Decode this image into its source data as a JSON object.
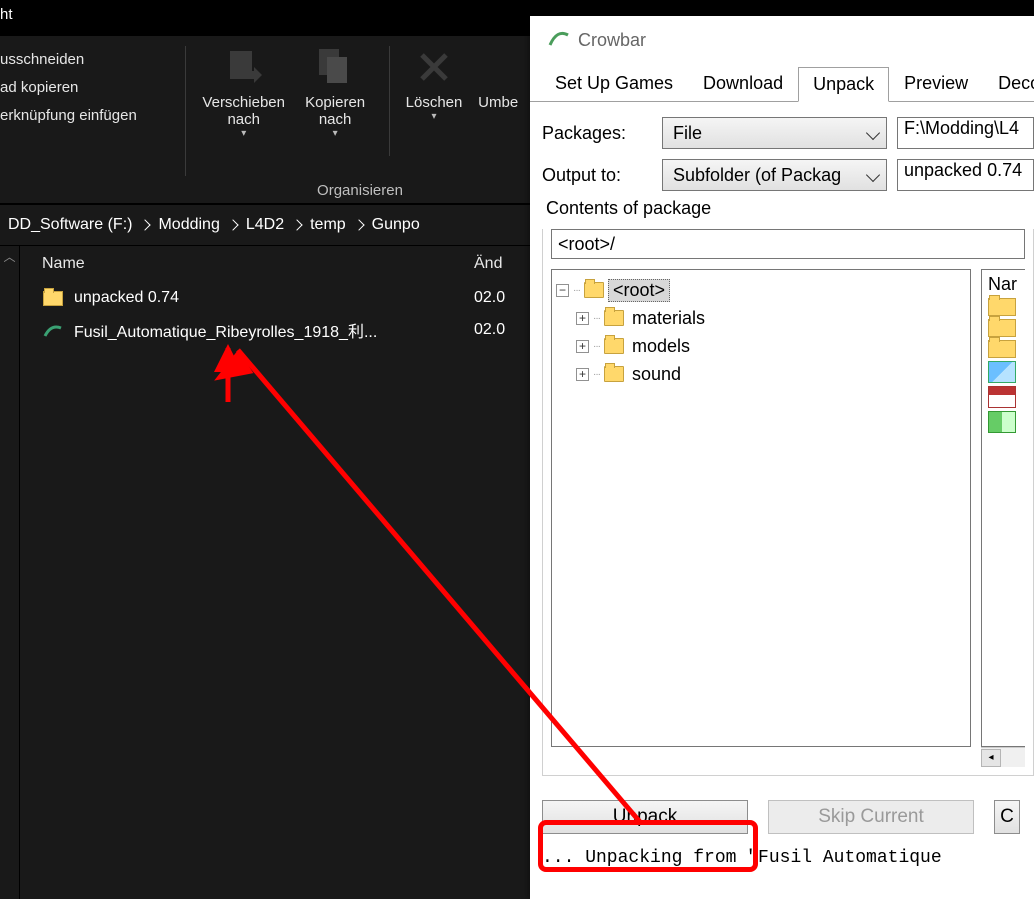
{
  "explorer": {
    "titleSuffix": "ht",
    "ribbon": {
      "clip": {
        "cut": "usschneiden",
        "copyPath": "ad kopieren",
        "pasteLink": "erknüpfung einfügen"
      },
      "organize": {
        "moveTo": "Verschieben nach",
        "copyTo": "Kopieren nach",
        "delete": "Löschen",
        "rename": "Umbe",
        "groupLabel": "Organisieren"
      }
    },
    "breadcrumb": [
      "DD_Software (F:)",
      "Modding",
      "L4D2",
      "temp",
      "Gunpo"
    ],
    "columns": {
      "name": "Name",
      "date": "Änd"
    },
    "files": [
      {
        "icon": "folder",
        "name": "unpacked 0.74",
        "date": "02.0"
      },
      {
        "icon": "crowbar",
        "name": "Fusil_Automatique_Ribeyrolles_1918_利...",
        "date": "02.0"
      }
    ]
  },
  "crowbar": {
    "title": "Crowbar",
    "tabs": [
      "Set Up Games",
      "Download",
      "Unpack",
      "Preview",
      "Decor"
    ],
    "activeTab": "Unpack",
    "form": {
      "packagesLabel": "Packages:",
      "packagesValue": "File",
      "packagesPath": "F:\\Modding\\L4",
      "outputLabel": "Output to:",
      "outputValue": "Subfolder (of Packag",
      "outputFolder": "unpacked 0.74"
    },
    "group": {
      "title": "Contents of package",
      "path": "<root>/",
      "tree": {
        "root": "<root>",
        "children": [
          "materials",
          "models",
          "sound"
        ]
      },
      "sideHeader": "Nar"
    },
    "buttons": {
      "unpack": "Unpack",
      "skip": "Skip Current",
      "other": "C"
    },
    "log": "...  Unpacking from \"Fusil Automatique"
  },
  "caret": "▾"
}
